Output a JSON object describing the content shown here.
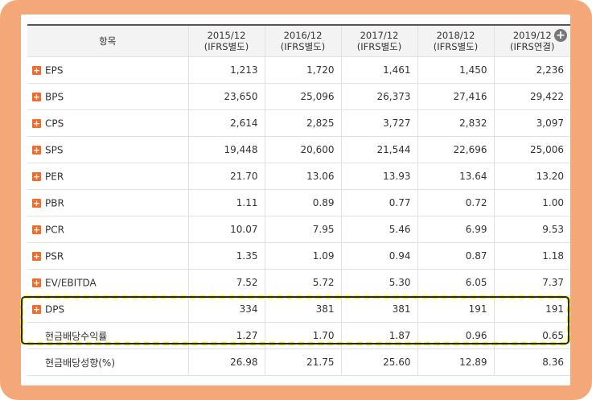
{
  "header": {
    "item_label": "항목",
    "columns": [
      {
        "period": "2015/12",
        "basis": "(IFRS별도)"
      },
      {
        "period": "2016/12",
        "basis": "(IFRS별도)"
      },
      {
        "period": "2017/12",
        "basis": "(IFRS별도)"
      },
      {
        "period": "2018/12",
        "basis": "(IFRS별도)"
      },
      {
        "period": "2019/12",
        "basis": "(IFRS연결)"
      }
    ],
    "add_column_icon": "plus-circle-icon"
  },
  "rows": [
    {
      "label": "EPS",
      "expandable": true,
      "values": [
        "1,213",
        "1,720",
        "1,461",
        "1,450",
        "2,236"
      ]
    },
    {
      "label": "BPS",
      "expandable": true,
      "values": [
        "23,650",
        "25,096",
        "26,373",
        "27,416",
        "29,422"
      ]
    },
    {
      "label": "CPS",
      "expandable": true,
      "values": [
        "2,614",
        "2,825",
        "3,727",
        "2,832",
        "3,097"
      ]
    },
    {
      "label": "SPS",
      "expandable": true,
      "values": [
        "19,448",
        "20,600",
        "21,544",
        "22,696",
        "25,006"
      ]
    },
    {
      "label": "PER",
      "expandable": true,
      "values": [
        "21.70",
        "13.06",
        "13.93",
        "13.64",
        "13.20"
      ]
    },
    {
      "label": "PBR",
      "expandable": true,
      "values": [
        "1.11",
        "0.89",
        "0.77",
        "0.72",
        "1.00"
      ]
    },
    {
      "label": "PCR",
      "expandable": true,
      "values": [
        "10.07",
        "7.95",
        "5.46",
        "6.99",
        "9.53"
      ]
    },
    {
      "label": "PSR",
      "expandable": true,
      "values": [
        "1.35",
        "1.09",
        "0.94",
        "0.87",
        "1.18"
      ]
    },
    {
      "label": "EV/EBITDA",
      "expandable": true,
      "values": [
        "7.52",
        "5.72",
        "5.30",
        "6.05",
        "7.37"
      ]
    },
    {
      "label": "DPS",
      "expandable": true,
      "values": [
        "334",
        "381",
        "381",
        "191",
        "191"
      ]
    },
    {
      "label": "현금배당수익률",
      "expandable": false,
      "values": [
        "1.27",
        "1.70",
        "1.87",
        "0.96",
        "0.65"
      ]
    },
    {
      "label": "현금배당성향(%)",
      "expandable": false,
      "values": [
        "26.98",
        "21.75",
        "25.60",
        "12.89",
        "8.36"
      ]
    }
  ],
  "colors": {
    "frame": "#f4a87a",
    "highlight": "#f5f500",
    "expand_icon": "#f36b2b"
  }
}
